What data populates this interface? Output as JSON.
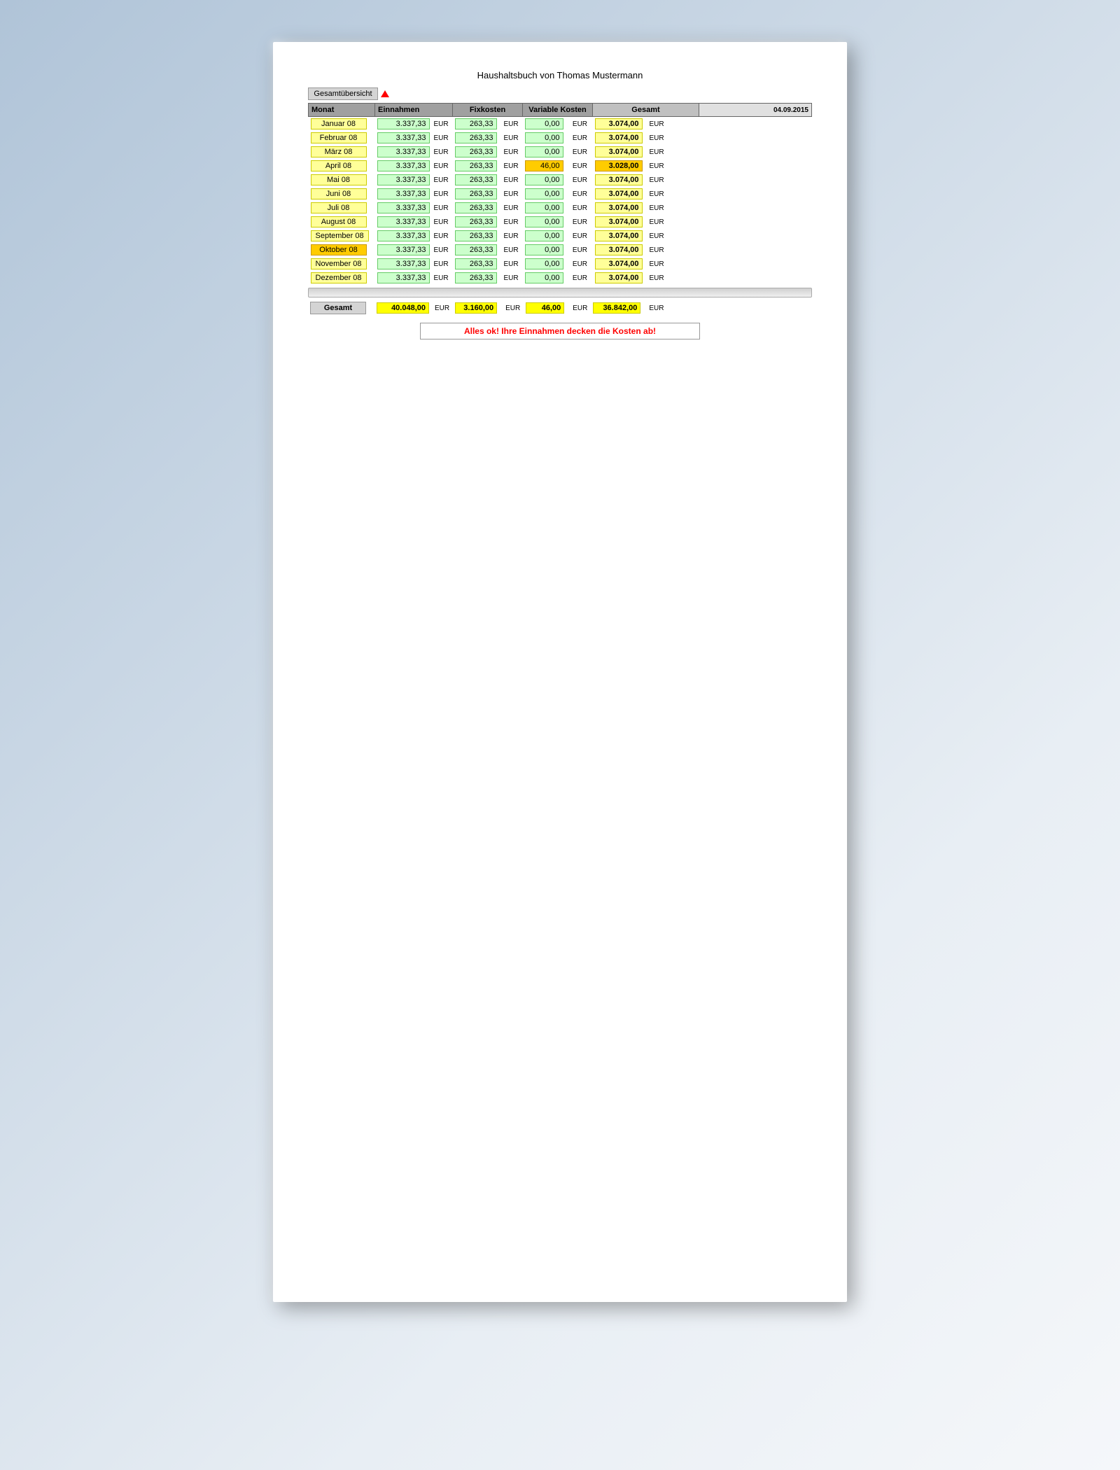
{
  "page": {
    "title": "Haushaltsbuch von Thomas Mustermann",
    "date": "04.09.2015",
    "gesamtuebersicht": "Gesamtübersicht",
    "headers": {
      "monat": "Monat",
      "einnahmen": "Einnahmen",
      "fixkosten": "Fixkosten",
      "variable_kosten": "Variable Kosten",
      "gesamt": "Gesamt"
    },
    "rows": [
      {
        "monat": "Januar 08",
        "orange": false,
        "einnahmen": "3.337,33",
        "fix": "263,33",
        "var": "0,00",
        "total": "3.074,00",
        "highlight": false
      },
      {
        "monat": "Februar 08",
        "orange": false,
        "einnahmen": "3.337,33",
        "fix": "263,33",
        "var": "0,00",
        "total": "3.074,00",
        "highlight": false
      },
      {
        "monat": "März 08",
        "orange": false,
        "einnahmen": "3.337,33",
        "fix": "263,33",
        "var": "0,00",
        "total": "3.074,00",
        "highlight": false
      },
      {
        "monat": "April 08",
        "orange": false,
        "einnahmen": "3.337,33",
        "fix": "263,33",
        "var": "46,00",
        "total": "3.028,00",
        "highlight": true
      },
      {
        "monat": "Mai 08",
        "orange": false,
        "einnahmen": "3.337,33",
        "fix": "263,33",
        "var": "0,00",
        "total": "3.074,00",
        "highlight": false
      },
      {
        "monat": "Juni 08",
        "orange": false,
        "einnahmen": "3.337,33",
        "fix": "263,33",
        "var": "0,00",
        "total": "3.074,00",
        "highlight": false
      },
      {
        "monat": "Juli 08",
        "orange": false,
        "einnahmen": "3.337,33",
        "fix": "263,33",
        "var": "0,00",
        "total": "3.074,00",
        "highlight": false
      },
      {
        "monat": "August 08",
        "orange": false,
        "einnahmen": "3.337,33",
        "fix": "263,33",
        "var": "0,00",
        "total": "3.074,00",
        "highlight": false
      },
      {
        "monat": "September 08",
        "orange": false,
        "einnahmen": "3.337,33",
        "fix": "263,33",
        "var": "0,00",
        "total": "3.074,00",
        "highlight": false
      },
      {
        "monat": "Oktober 08",
        "orange": true,
        "einnahmen": "3.337,33",
        "fix": "263,33",
        "var": "0,00",
        "total": "3.074,00",
        "highlight": false
      },
      {
        "monat": "November 08",
        "orange": false,
        "einnahmen": "3.337,33",
        "fix": "263,33",
        "var": "0,00",
        "total": "3.074,00",
        "highlight": false
      },
      {
        "monat": "Dezember 08",
        "orange": false,
        "einnahmen": "3.337,33",
        "fix": "263,33",
        "var": "0,00",
        "total": "3.074,00",
        "highlight": false
      }
    ],
    "totals": {
      "label": "Gesamt",
      "einnahmen": "40.048,00",
      "fix": "3.160,00",
      "var": "46,00",
      "net": "36.842,00"
    },
    "status_message": "Alles ok! Ihre Einnahmen decken die Kosten ab!",
    "eur": "EUR"
  }
}
